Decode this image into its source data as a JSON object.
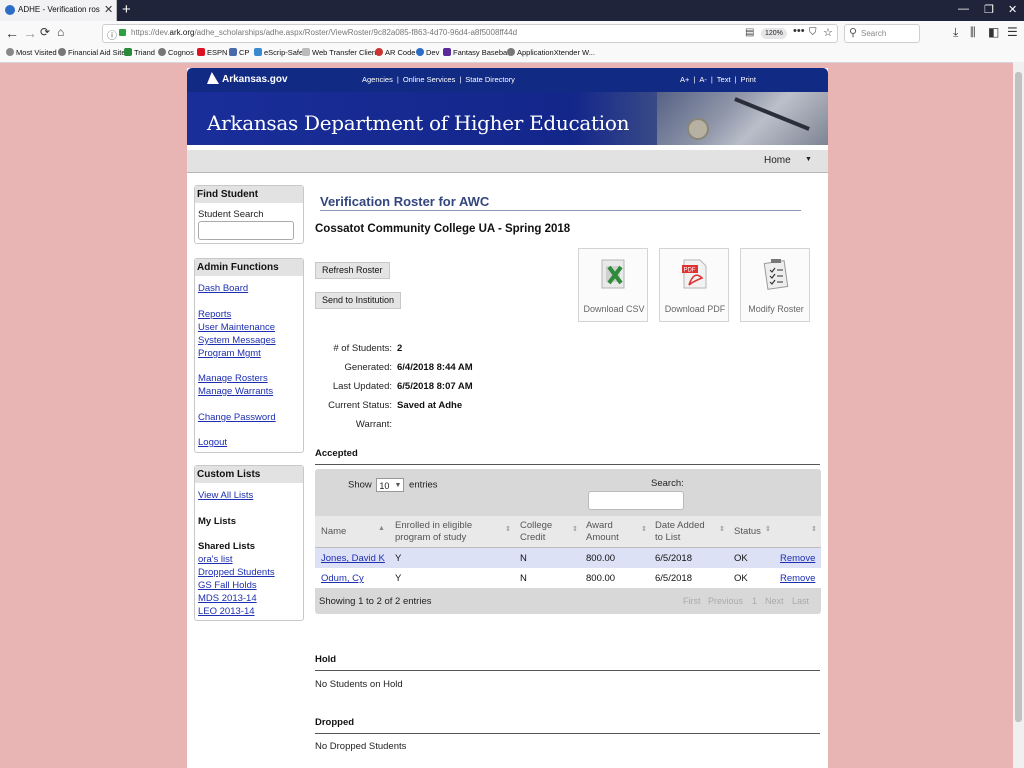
{
  "browser": {
    "tab_title": "ADHE - Verification roster for AW",
    "url_prefix": "https://dev.",
    "url_domain": "ark.org",
    "url_rest": "/adhe_scholarships/adhe.aspx/Roster/ViewRoster/9c82a085-f863-4d70-96d4-a8f5008ff44d",
    "zoom": "120%",
    "search_placeholder": "Search",
    "bookmarks": [
      "Most Visited",
      "Financial Aid Site",
      "Triand",
      "Cognos",
      "ESPN",
      "CP",
      "eScrip-Safe",
      "Web Transfer Client",
      "AR Code",
      "Dev",
      "Fantasy Baseball",
      "ApplicationXtender W..."
    ]
  },
  "site": {
    "logo": "Arkansas.gov",
    "top_links": [
      "Agencies",
      "Online Services",
      "State Directory"
    ],
    "size_links": [
      "A+",
      "A-",
      "Text",
      "Print"
    ],
    "banner_title": "Arkansas Department of Higher Education",
    "menu_home": "Home"
  },
  "sidebar": {
    "find_student": {
      "title": "Find Student",
      "label": "Student Search"
    },
    "admin": {
      "title": "Admin Functions",
      "links": [
        "Dash Board",
        "Reports",
        "User Maintenance",
        "System Messages",
        "Program Mgmt",
        "Manage Rosters",
        "Manage Warrants",
        "Change Password",
        "Logout"
      ]
    },
    "custom_lists": {
      "title": "Custom Lists",
      "view_all": "View All Lists",
      "my_lists": "My Lists",
      "shared_lists": "Shared Lists",
      "shared": [
        "ora's list",
        "Dropped Students",
        "GS Fall Holds",
        "MDS 2013-14",
        "LEO 2013-14"
      ]
    }
  },
  "main": {
    "title": "Verification Roster for AWC",
    "college": "Cossatot Community College UA - Spring 2018",
    "buttons": {
      "refresh": "Refresh Roster",
      "send": "Send to Institution"
    },
    "tiles": {
      "csv": "Download CSV",
      "pdf": "Download PDF",
      "modify": "Modify Roster"
    },
    "info": {
      "students_label": "# of Students:",
      "students": "2",
      "generated_label": "Generated:",
      "generated": "6/4/2018 8:44 AM",
      "updated_label": "Last Updated:",
      "updated": "6/5/2018 8:07 AM",
      "status_label": "Current Status:",
      "status": "Saved at Adhe",
      "warrant_label": "Warrant:",
      "warrant": ""
    },
    "accepted": {
      "heading": "Accepted",
      "show": "Show",
      "entries_count": "10",
      "entries": "entries",
      "search_label": "Search:",
      "columns": [
        "Name",
        "Enrolled in eligible",
        "program of study",
        "College",
        "Credit",
        "Award",
        "Amount",
        "Date Added",
        "to List",
        "Status"
      ],
      "rows": [
        {
          "name": "Jones, David K",
          "enrolled": "Y",
          "credit": "N",
          "amount": "800.00",
          "date": "6/5/2018",
          "status": "OK",
          "action": "Remove"
        },
        {
          "name": "Odum, Cy",
          "enrolled": "Y",
          "credit": "N",
          "amount": "800.00",
          "date": "6/5/2018",
          "status": "OK",
          "action": "Remove"
        }
      ],
      "footer": "Showing 1 to 2 of 2 entries",
      "pager": [
        "First",
        "Previous",
        "1",
        "Next",
        "Last"
      ]
    },
    "hold": {
      "heading": "Hold",
      "message": "No Students on Hold"
    },
    "dropped": {
      "heading": "Dropped",
      "message": "No Dropped Students"
    }
  }
}
